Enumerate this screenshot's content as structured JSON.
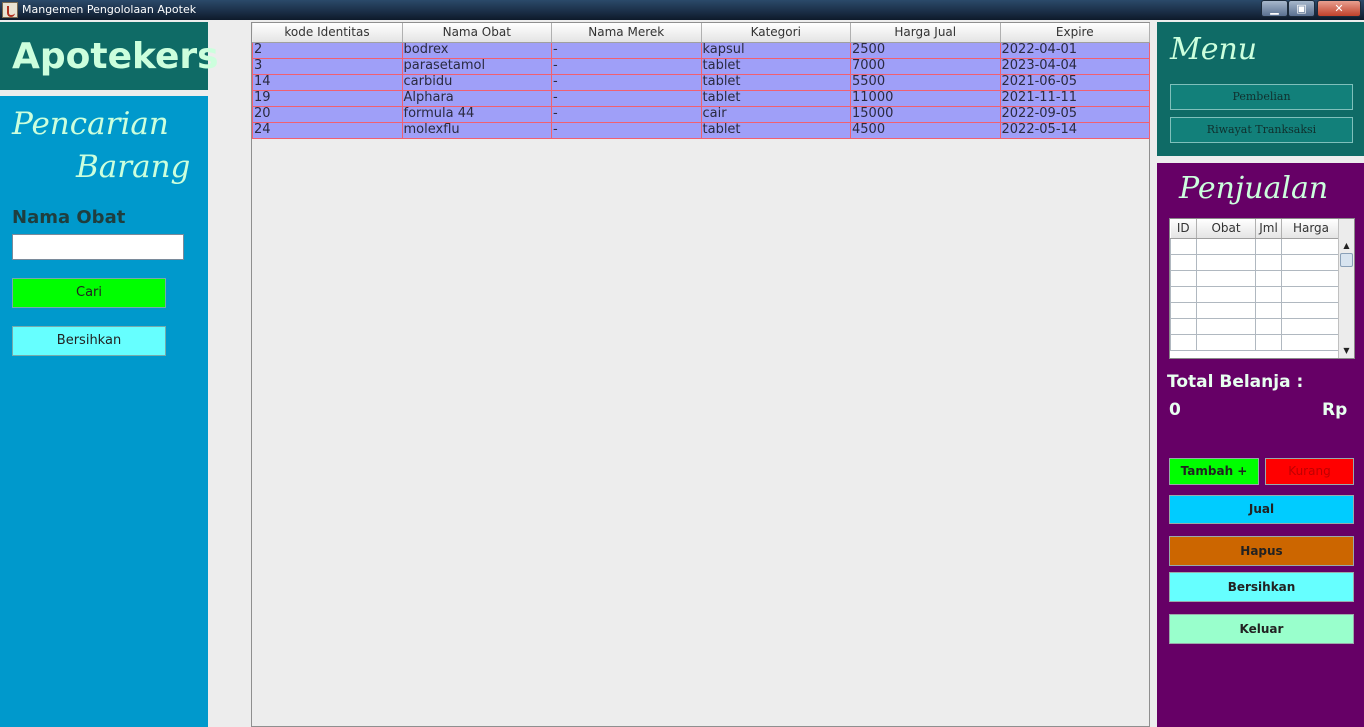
{
  "window": {
    "title": "Mangemen Pengololaan Apotek",
    "minimize": "▁",
    "maximize": "▣",
    "close": "✕"
  },
  "sidebar": {
    "brand": "Apotekers",
    "search_title_line1": "Pencarian",
    "search_title_line2": "Barang",
    "name_label": "Nama Obat",
    "name_value": "",
    "search_button": "Cari",
    "clear_button": "Bersihkan"
  },
  "table": {
    "columns": [
      "kode Identitas",
      "Nama Obat",
      "Nama Merek",
      "Kategori",
      "Harga Jual",
      "Expire"
    ],
    "rows": [
      [
        "2",
        "bodrex",
        "-",
        "kapsul",
        "2500",
        "2022-04-01"
      ],
      [
        "3",
        "parasetamol",
        "-",
        "tablet",
        "7000",
        "2023-04-04"
      ],
      [
        "14",
        "carbidu",
        "-",
        "tablet",
        "5500",
        "2021-06-05"
      ],
      [
        "19",
        "Alphara",
        "-",
        "tablet",
        "11000",
        "2021-11-11"
      ],
      [
        "20",
        "formula 44",
        "-",
        "cair",
        "15000",
        "2022-09-05"
      ],
      [
        "24",
        "molexflu",
        "-",
        "tablet",
        "4500",
        "2022-05-14"
      ]
    ]
  },
  "menu": {
    "title": "Menu",
    "purchase_button": "Pembelian",
    "history_button": "Riwayat Tranksaksi"
  },
  "sales": {
    "title": "Penjualan",
    "cart_columns": [
      "ID",
      "Obat",
      "Jml",
      "Harga"
    ],
    "total_label": "Total Belanja :",
    "total_value": "0",
    "currency": "Rp",
    "add_button": "Tambah +",
    "reduce_button": "Kurang",
    "sell_button": "Jual",
    "delete_button": "Hapus",
    "clear_button": "Bersihkan",
    "exit_button": "Keluar"
  },
  "colors": {
    "left_panel": "#0099cc",
    "brand_panel": "#0f6b66",
    "sales_panel": "#660066",
    "table_row": "#9f9ff8",
    "table_grid": "#f06070"
  }
}
